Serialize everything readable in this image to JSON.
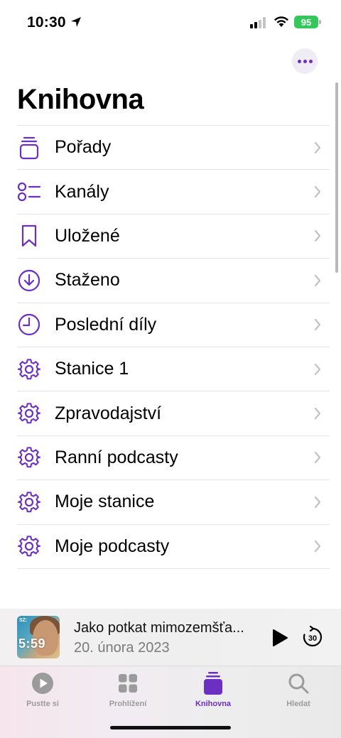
{
  "status_bar": {
    "time": "10:30",
    "battery": "95"
  },
  "header": {
    "title": "Knihovna",
    "more_icon": "ellipsis-icon"
  },
  "library_items": [
    {
      "label": "Pořady",
      "icon": "shows-stack-icon"
    },
    {
      "label": "Kanály",
      "icon": "channels-list-icon"
    },
    {
      "label": "Uložené",
      "icon": "bookmark-icon"
    },
    {
      "label": "Staženo",
      "icon": "download-circle-icon"
    },
    {
      "label": "Poslední díly",
      "icon": "clock-icon"
    },
    {
      "label": "Stanice 1",
      "icon": "gear-icon"
    },
    {
      "label": "Zpravodajství",
      "icon": "gear-icon"
    },
    {
      "label": "Ranní podcasty",
      "icon": "gear-icon"
    },
    {
      "label": "Moje stanice",
      "icon": "gear-icon"
    },
    {
      "label": "Moje podcasty",
      "icon": "gear-icon"
    }
  ],
  "mini_player": {
    "artwork_tag": "SZ:",
    "artwork_time": "5:59",
    "title": "Jako potkat mimozemšťa...",
    "date": "20. února 2023"
  },
  "tabs": [
    {
      "label": "Pustte si",
      "icon": "play-circle-icon",
      "active": false
    },
    {
      "label": "Prohlížení",
      "icon": "grid-icon",
      "active": false
    },
    {
      "label": "Knihovna",
      "icon": "library-stack-icon",
      "active": true
    },
    {
      "label": "Hledat",
      "icon": "search-icon",
      "active": false
    }
  ],
  "colors": {
    "accent": "#6b2fc4",
    "inactive": "#9b9b9b"
  }
}
